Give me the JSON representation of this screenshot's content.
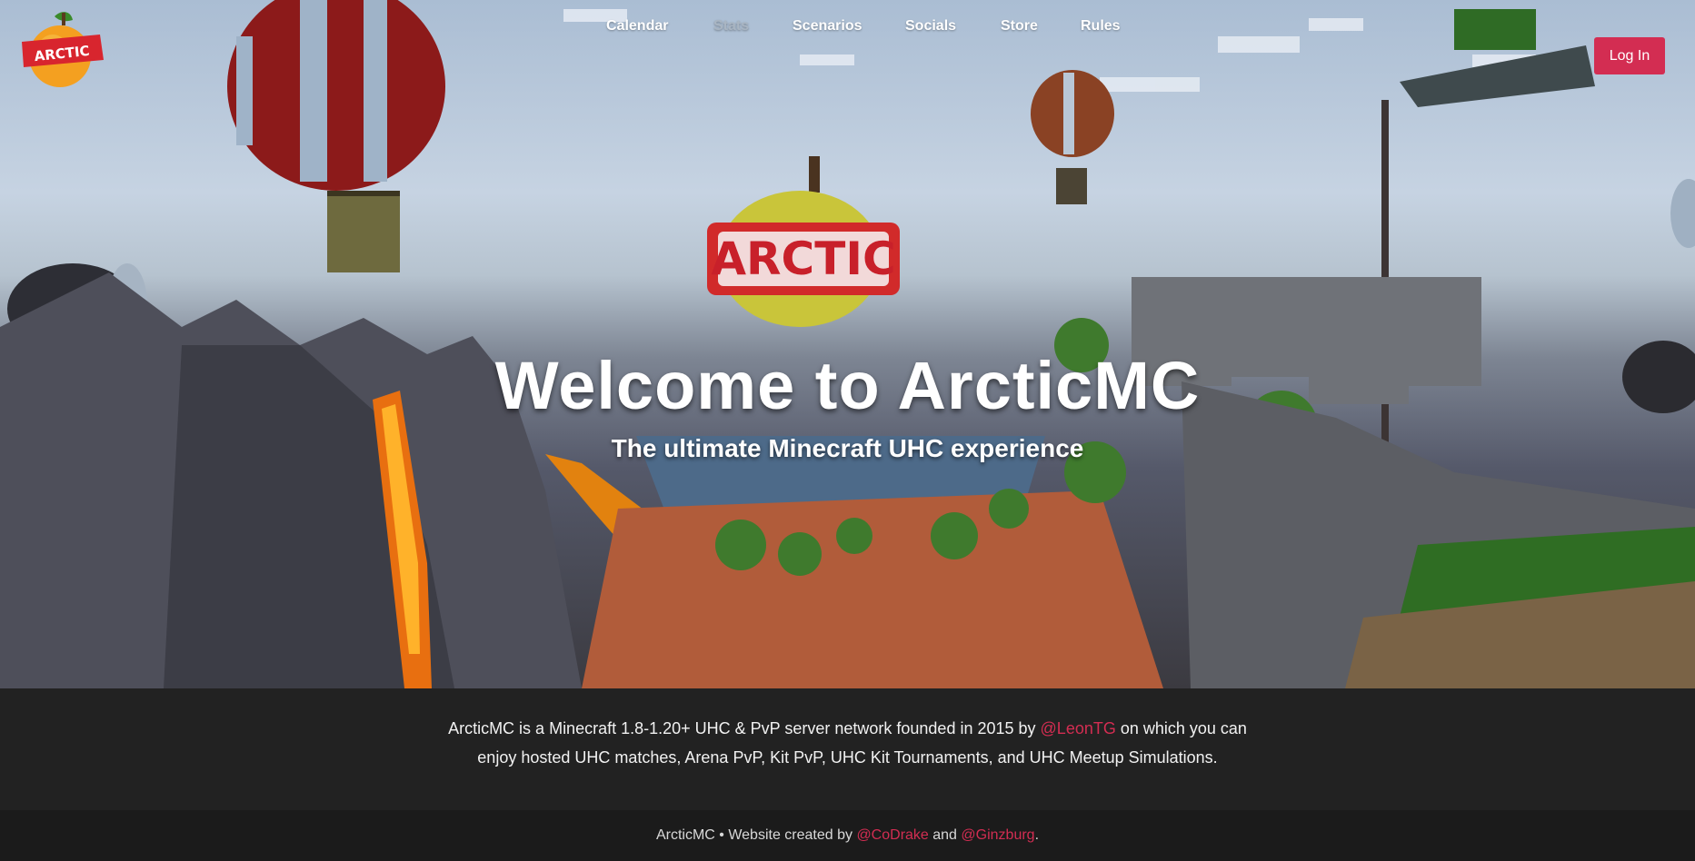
{
  "header": {
    "logo_text": "ARCTIC",
    "nav": [
      {
        "label": "Calendar"
      },
      {
        "label": "Stats"
      },
      {
        "label": "Scenarios"
      },
      {
        "label": "Socials"
      },
      {
        "label": "Store"
      },
      {
        "label": "Rules"
      }
    ],
    "login_label": "Log In"
  },
  "hero": {
    "sign_text": "ARCTIC",
    "title": "Welcome to ArcticMC",
    "subtitle": "The ultimate Minecraft UHC experience"
  },
  "about": {
    "text_before": "ArcticMC is a Minecraft 1.8-1.20+ UHC & PvP server network founded in 2015 by ",
    "founder_link": "@LeonTG",
    "text_after": " on which you can enjoy hosted UHC matches, Arena PvP, Kit PvP, UHC Kit Tournaments, and UHC Meetup Simulations."
  },
  "footer": {
    "text_before": "ArcticMC • Website created by ",
    "author1": "@CoDrake",
    "and": " and ",
    "author2": "@Ginzburg",
    "period": "."
  },
  "colors": {
    "accent": "#d32d52",
    "nav_muted": "#a9b5c2",
    "about_bg": "#222222",
    "footer_bg": "#1b1b1b"
  }
}
